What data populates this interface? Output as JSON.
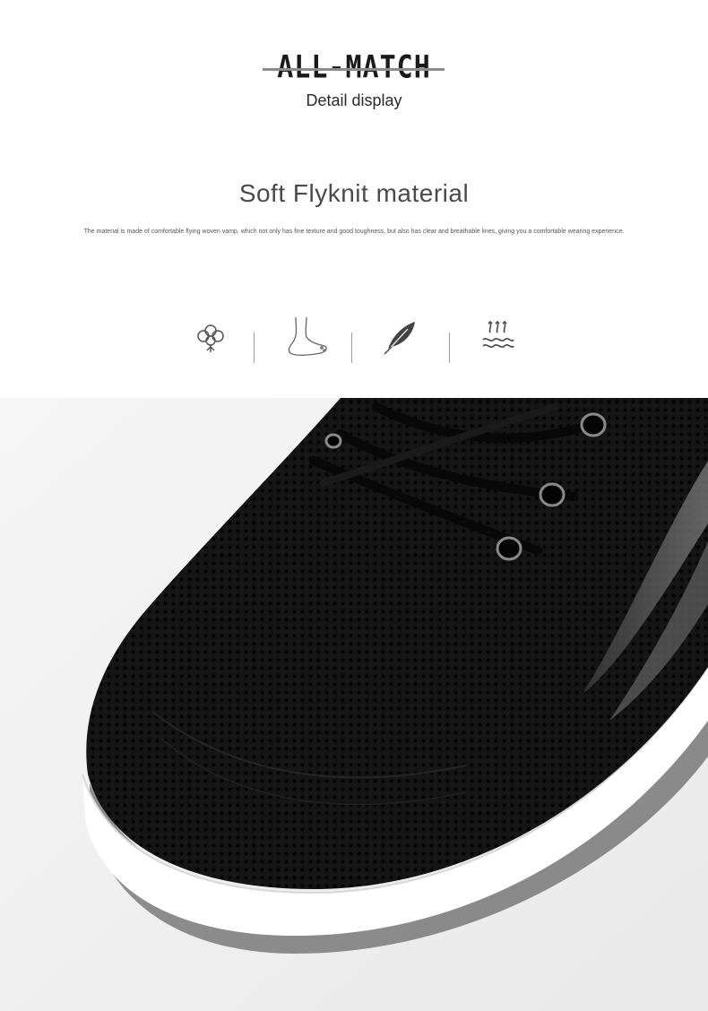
{
  "header": {
    "brand": "ALL-MATCH",
    "subtitle": "Detail display"
  },
  "section": {
    "title": "Soft Flyknit material",
    "description": "The material is made of comfortable flying woven vamp, which not only has fine texture and good toughness, but also has clear and breathable lines, giving you a comfortable wearing experience."
  },
  "features": [
    {
      "icon": "cotton-flower-icon"
    },
    {
      "icon": "foot-icon"
    },
    {
      "icon": "feather-icon"
    },
    {
      "icon": "breathable-waves-icon"
    }
  ],
  "photo": {
    "subject": "shoe-photo",
    "colors": {
      "upper": "#141414",
      "sole": "#ffffff",
      "accent": "#5a5a5a",
      "background": "#f2f2f2"
    }
  }
}
